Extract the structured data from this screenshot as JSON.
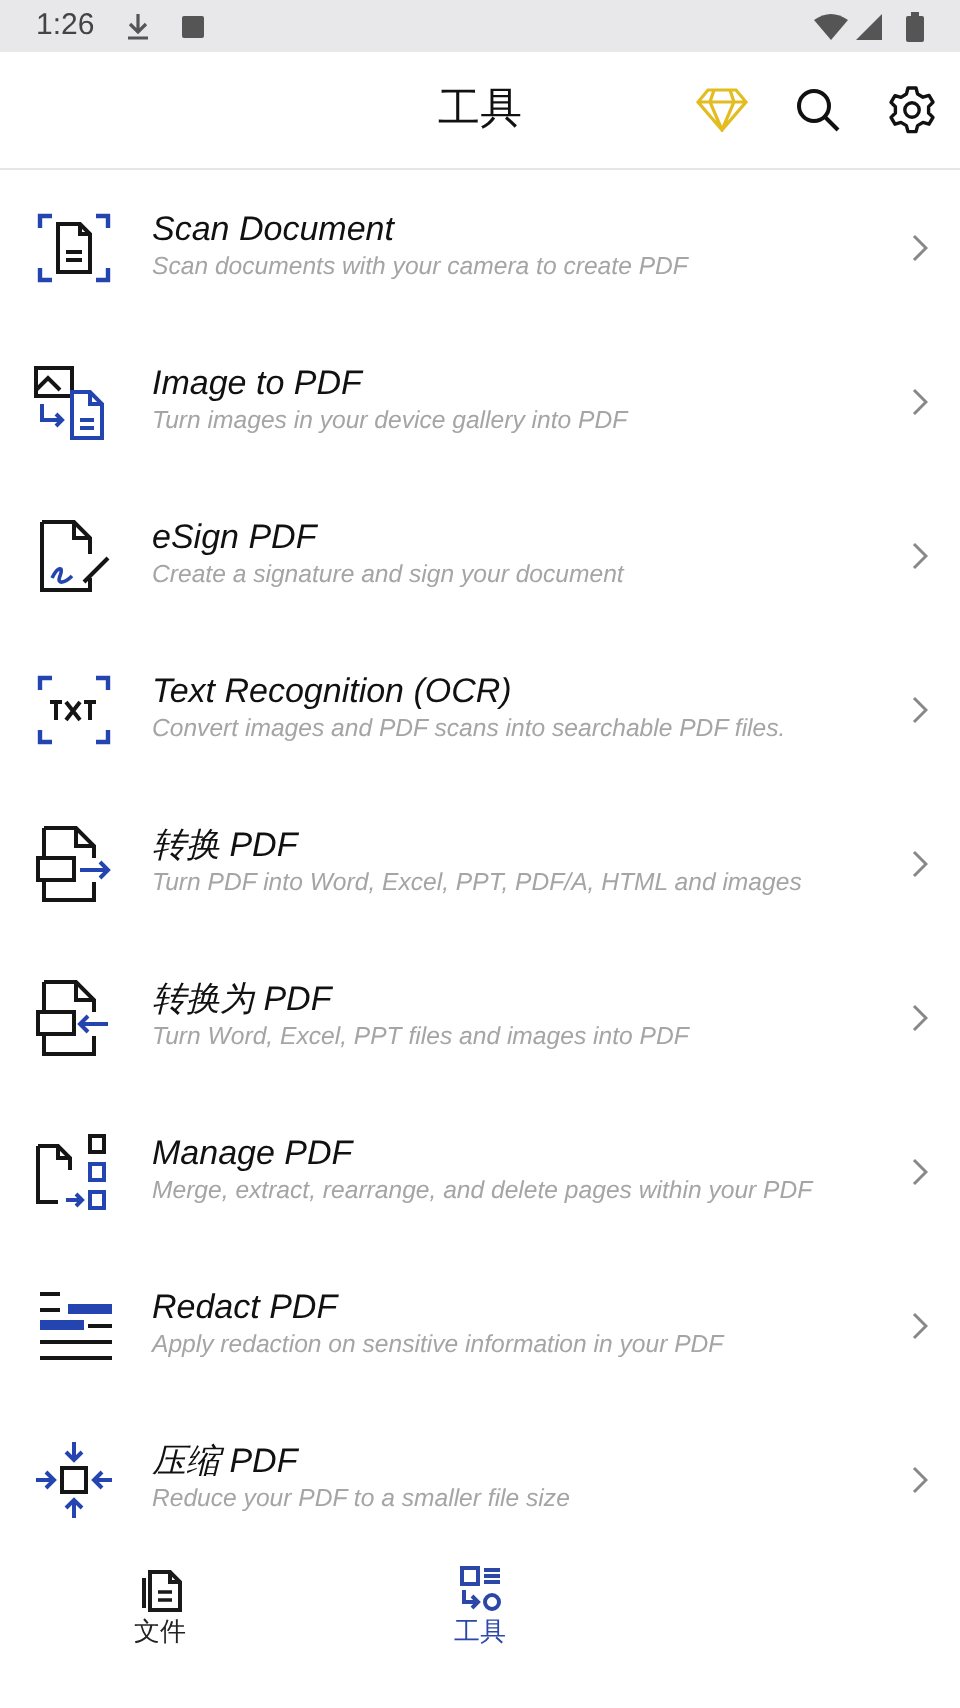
{
  "status_bar": {
    "time": "1:26"
  },
  "header": {
    "title": "工具"
  },
  "tools": [
    {
      "title": "Scan Document",
      "subtitle": "Scan documents with your camera to create PDF"
    },
    {
      "title": "Image to PDF",
      "subtitle": "Turn images in your device gallery into PDF"
    },
    {
      "title": "eSign PDF",
      "subtitle": "Create a signature and sign your document"
    },
    {
      "title": "Text Recognition (OCR)",
      "subtitle": "Convert images and PDF scans into searchable PDF files."
    },
    {
      "title": "转换 PDF",
      "subtitle": "Turn PDF into Word, Excel, PPT, PDF/A, HTML and images"
    },
    {
      "title": "转换为 PDF",
      "subtitle": "Turn Word, Excel, PPT files and images into PDF"
    },
    {
      "title": "Manage PDF",
      "subtitle": "Merge, extract, rearrange, and delete pages within your PDF"
    },
    {
      "title": "Redact PDF",
      "subtitle": "Apply redaction on sensitive information in your PDF"
    },
    {
      "title": "压缩 PDF",
      "subtitle": "Reduce your PDF to a smaller file size"
    }
  ],
  "bottom_nav": [
    {
      "label": "文件",
      "selected": false
    },
    {
      "label": "工具",
      "selected": true
    }
  ]
}
